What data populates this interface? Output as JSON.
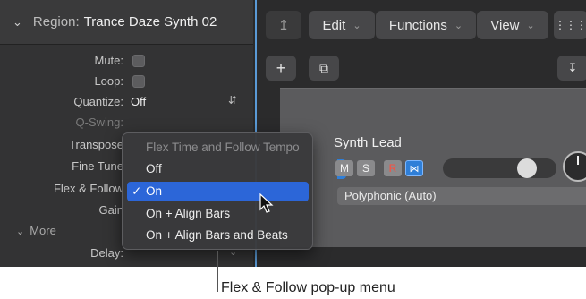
{
  "region": {
    "label": "Region:",
    "name": "Trance Daze Synth 02"
  },
  "inspector_rows": {
    "mute": "Mute:",
    "loop": "Loop:",
    "quantize": "Quantize:",
    "quantize_value": "Off",
    "q_swing": "Q-Swing:",
    "transpose": "Transpose",
    "fine_tune": "Fine Tune",
    "flex_follow": "Flex & Follow",
    "gain": "Gain",
    "more": "More",
    "delay": "Delay:"
  },
  "toolbar": {
    "edit": "Edit",
    "functions": "Functions",
    "view": "View"
  },
  "track": {
    "name": "Synth Lead",
    "mute": "M",
    "solo": "S",
    "record": "R",
    "play_mode": "Polyphonic (Auto)"
  },
  "menu": {
    "title": "Flex Time and Follow Tempo",
    "items": [
      "Off",
      "On",
      "On + Align Bars",
      "On + Align Bars and Beats"
    ],
    "selected": "On"
  },
  "callout": "Flex & Follow pop-up menu",
  "colors": {
    "accent": "#2c66d8",
    "record": "#ff4d3d",
    "panel": "#333334"
  }
}
